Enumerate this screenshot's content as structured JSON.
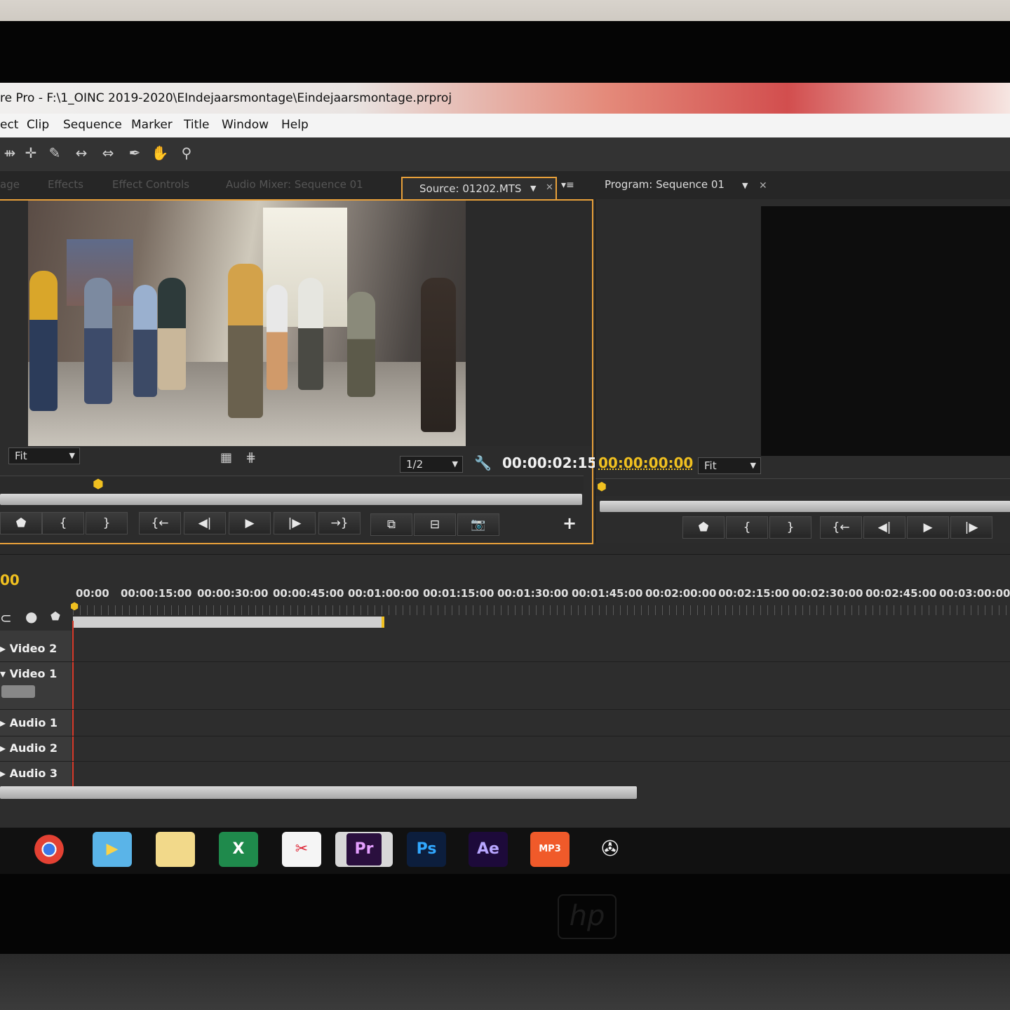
{
  "window": {
    "title": "re Pro - F:\\1_OINC 2019-2020\\EIndejaarsmontage\\Eindejaarsmontage.prproj"
  },
  "menu": [
    "ect",
    "Clip",
    "Sequence",
    "Marker",
    "Title",
    "Window",
    "Help"
  ],
  "tools": [
    "track-select-icon",
    "ripple-edit-icon",
    "razor-icon",
    "slip-icon",
    "slide-icon",
    "pen-icon",
    "hand-icon",
    "zoom-icon"
  ],
  "tabs": {
    "dim": [
      "age",
      "Effects",
      "Effect Controls",
      "Audio Mixer: Sequence 01"
    ],
    "source": "Source: 01202.MTS",
    "program": "Program: Sequence 01"
  },
  "source_monitor": {
    "zoom": "Fit",
    "resolution": "1/2",
    "timecode": "00:00:02:15"
  },
  "program_monitor": {
    "timecode": "00:00:00:00",
    "zoom": "Fit"
  },
  "timeline": {
    "timecode": "00",
    "ticks": [
      "00:00",
      "00:00:15:00",
      "00:00:30:00",
      "00:00:45:00",
      "00:01:00:00",
      "00:01:15:00",
      "00:01:30:00",
      "00:01:45:00",
      "00:02:00:00",
      "00:02:15:00",
      "00:02:30:00",
      "00:02:45:00",
      "00:03:00:00"
    ],
    "tracks": [
      "Video 2",
      "Video 1",
      "Audio 1",
      "Audio 2",
      "Audio 3"
    ]
  },
  "taskbar": [
    "Chrome",
    "Movie Maker",
    "File Explorer",
    "Excel",
    "Snipping Tool",
    "Pr",
    "Ps",
    "Ae",
    "MP3",
    "Media"
  ]
}
